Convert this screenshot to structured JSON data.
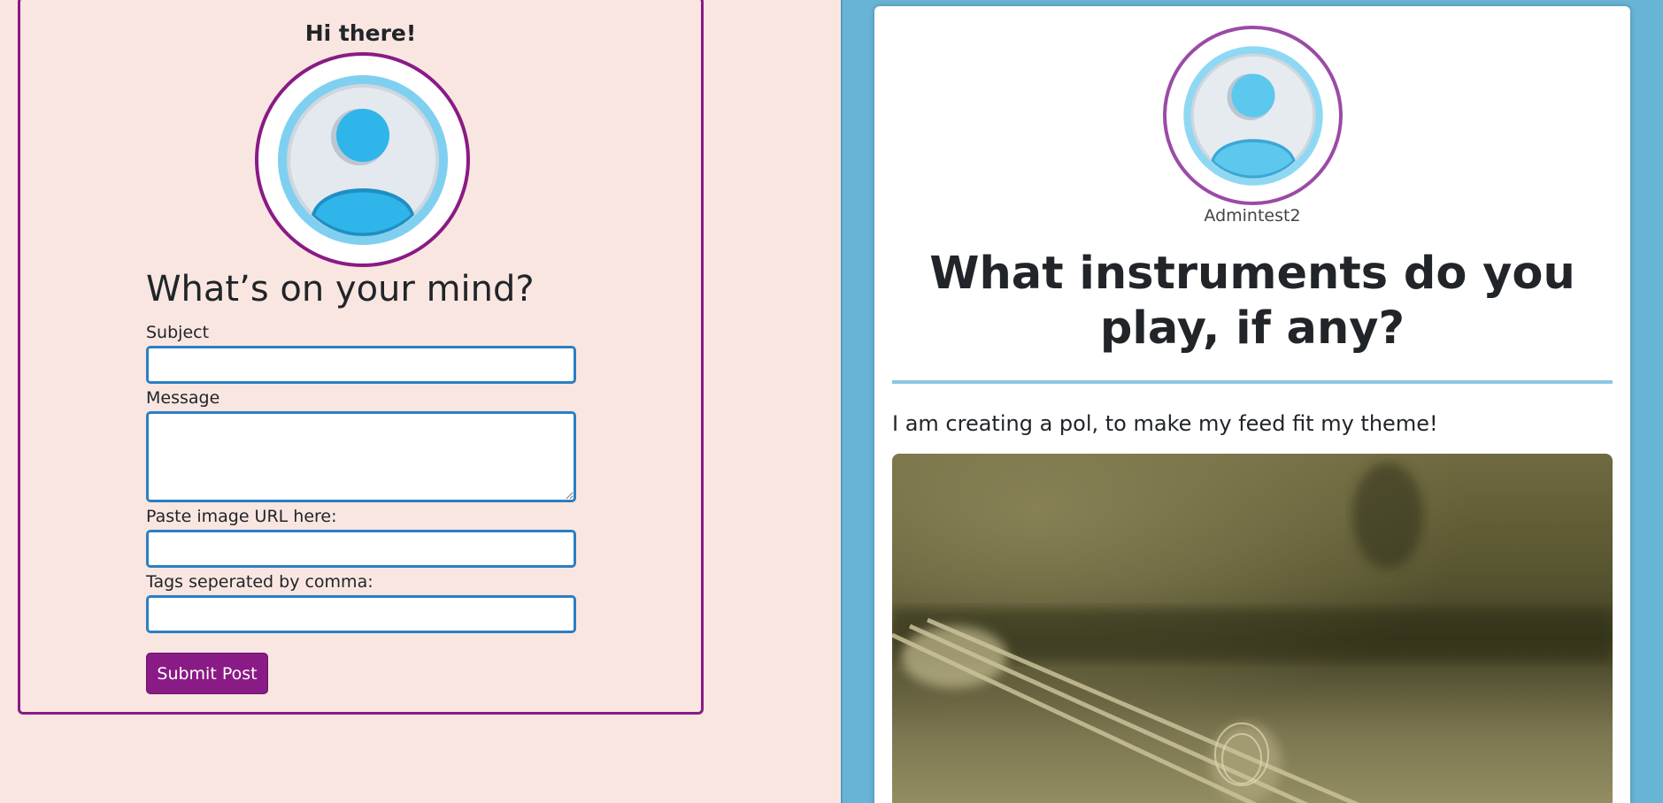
{
  "compose": {
    "greeting": "Hi there!",
    "title": "What’s on your mind?",
    "fields": {
      "subject": {
        "label": "Subject",
        "value": ""
      },
      "message": {
        "label": "Message",
        "value": ""
      },
      "image_url": {
        "label": "Paste image URL here:",
        "value": ""
      },
      "tags": {
        "label": "Tags seperated by comma:",
        "value": ""
      }
    },
    "submit_label": "Submit Post",
    "avatar_icon": "user-avatar-icon"
  },
  "feed": {
    "post": {
      "username": "Admintest2",
      "title": "What instruments do you play, if any?",
      "body": "I am creating a pol, to make my feed fit my theme!",
      "avatar_icon": "user-avatar-icon",
      "image_icon": "guitar-strings-photo"
    }
  },
  "colors": {
    "accent_purple": "#8a1a85",
    "input_border": "#2b7fc4",
    "left_bg": "#f9e6e1",
    "right_bg": "#67b4d6",
    "divider": "#8ac7e0"
  }
}
